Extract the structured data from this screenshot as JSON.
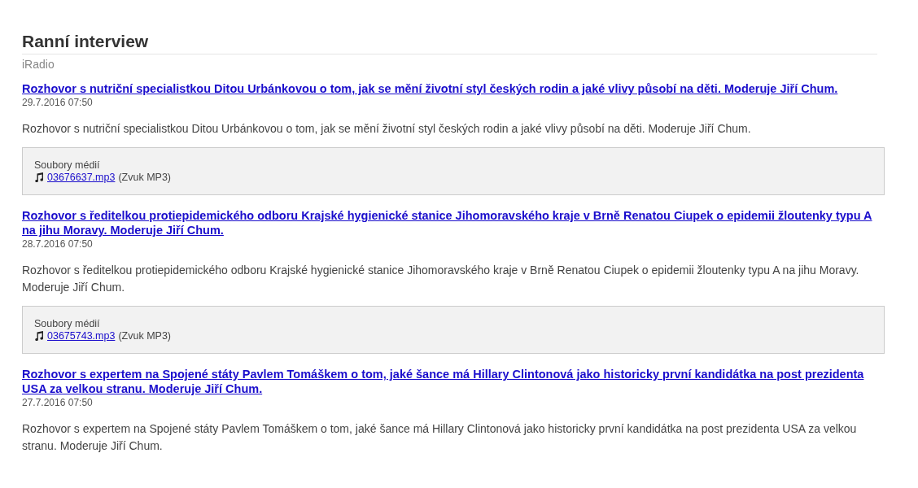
{
  "page": {
    "title": "Ranní interview",
    "subtitle": "iRadio"
  },
  "articles": [
    {
      "title": "Rozhovor s nutriční specialistkou Ditou Urbánkovou o tom, jak se mění životní styl českých rodin a jaké vlivy působí na děti. Moderuje Jiří Chum.",
      "date": "29.7.2016 07:50",
      "summary": "Rozhovor s nutriční specialistkou Ditou Urbánkovou o tom, jak se mění životní styl českých rodin a jaké vlivy působí na děti. Moderuje Jiří Chum.",
      "media": {
        "heading": "Soubory médií",
        "file": "03676637.mp3",
        "type": "(Zvuk MP3)"
      }
    },
    {
      "title": "Rozhovor s ředitelkou protiepidemického odboru Krajské hygienické stanice Jihomoravského kraje v Brně Renatou Ciupek o epidemii žloutenky typu A na jihu Moravy. Moderuje Jiří Chum.",
      "date": "28.7.2016 07:50",
      "summary": "Rozhovor s ředitelkou protiepidemického odboru Krajské hygienické stanice Jihomoravského kraje v Brně Renatou Ciupek o epidemii žloutenky typu A na jihu Moravy. Moderuje Jiří Chum.",
      "media": {
        "heading": "Soubory médií",
        "file": "03675743.mp3",
        "type": "(Zvuk MP3)"
      }
    },
    {
      "title": "Rozhovor s expertem na Spojené státy Pavlem Tomáškem o tom, jaké šance má Hillary Clintonová jako historicky první kandidátka na post prezidenta USA za velkou stranu. Moderuje Jiří Chum.",
      "date": "27.7.2016 07:50",
      "summary": "Rozhovor s expertem na Spojené státy Pavlem Tomáškem o tom, jaké šance má Hillary Clintonová jako historicky první kandidátka na post prezidenta USA za velkou stranu. Moderuje Jiří Chum."
    }
  ]
}
